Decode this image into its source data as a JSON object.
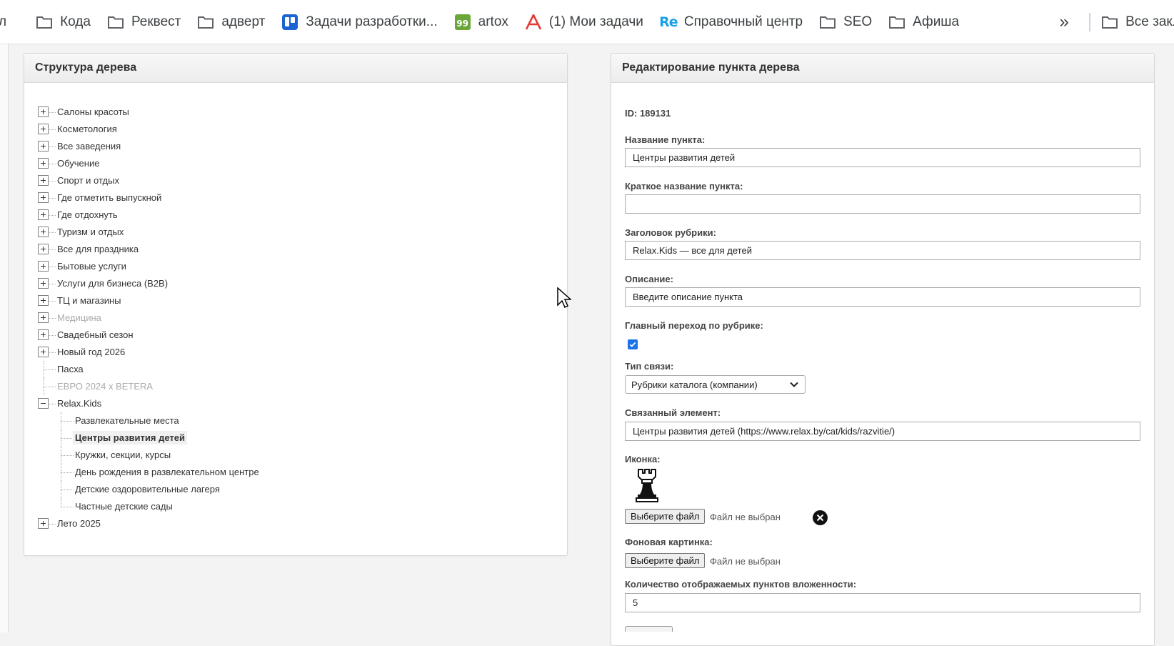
{
  "bookmarks": {
    "items": [
      {
        "label": "л",
        "icon": "folder-icon"
      },
      {
        "label": "Кода",
        "icon": "folder-icon"
      },
      {
        "label": "Реквест",
        "icon": "folder-icon"
      },
      {
        "label": "адверт",
        "icon": "folder-icon"
      },
      {
        "label": "Задачи разработки...",
        "icon": "trello-icon"
      },
      {
        "label": "artox",
        "icon": "artox-99-icon"
      },
      {
        "label": "(1) Мои задачи",
        "icon": "red-a-icon"
      },
      {
        "label": "Справочный центр",
        "icon": "re-icon"
      },
      {
        "label": "SEO",
        "icon": "folder-icon"
      },
      {
        "label": "Афиша",
        "icon": "folder-icon"
      }
    ],
    "more_label": "»",
    "all_bookmarks": "Все закладки"
  },
  "tree_panel": {
    "title": "Структура дерева",
    "nodes": [
      {
        "label": "Салоны красоты",
        "state": "collapsed"
      },
      {
        "label": "Косметология",
        "state": "collapsed"
      },
      {
        "label": "Все заведения",
        "state": "collapsed"
      },
      {
        "label": "Обучение",
        "state": "collapsed"
      },
      {
        "label": "Спорт и отдых",
        "state": "collapsed"
      },
      {
        "label": "Где отметить выпускной",
        "state": "collapsed"
      },
      {
        "label": "Где отдохнуть",
        "state": "collapsed"
      },
      {
        "label": "Туризм и отдых",
        "state": "collapsed"
      },
      {
        "label": "Все для праздника",
        "state": "collapsed"
      },
      {
        "label": "Бытовые услуги",
        "state": "collapsed"
      },
      {
        "label": "Услуги для бизнеса (B2B)",
        "state": "collapsed"
      },
      {
        "label": "ТЦ и магазины",
        "state": "collapsed"
      },
      {
        "label": "Медицина",
        "state": "collapsed",
        "disabled": true
      },
      {
        "label": "Свадебный сезон",
        "state": "collapsed"
      },
      {
        "label": "Новый год 2026",
        "state": "collapsed"
      },
      {
        "label": "Пасха",
        "state": "leaf"
      },
      {
        "label": "ЕВРО 2024 x BETERA",
        "state": "leaf",
        "disabled": true
      },
      {
        "label": "Relax.Kids",
        "state": "expanded"
      },
      {
        "label": "Развлекательные места",
        "state": "child"
      },
      {
        "label": "Центры развития детей",
        "state": "child",
        "selected": true
      },
      {
        "label": "Кружки, секции, курсы",
        "state": "child"
      },
      {
        "label": "День рождения в развлекательном центре",
        "state": "child"
      },
      {
        "label": "Детские оздоровительные лагеря",
        "state": "child"
      },
      {
        "label": "Частные детские сады",
        "state": "child"
      },
      {
        "label": "Лето 2025",
        "state": "collapsed"
      }
    ]
  },
  "edit_panel": {
    "title": "Редактирование пункта дерева",
    "id_text": "ID: 189131",
    "name_label": "Название пункта:",
    "name_value": "Центры развития детей",
    "short_name_label": "Краткое название пункта:",
    "short_name_value": "",
    "heading_label": "Заголовок рубрики:",
    "heading_value": "Relax.Kids — все для детей",
    "description_label": "Описание:",
    "description_value": "Введите описание пункта",
    "main_link_label": "Главный переход по рубрике:",
    "main_link_checked": true,
    "link_type_label": "Тип связи:",
    "link_type_value": "Рубрики каталога (компании)",
    "linked_element_label": "Связанный элемент:",
    "linked_element_value": "Центры развития детей (https://www.relax.by/cat/kids/razvitie/)",
    "icon_label": "Иконка:",
    "icon_image": "chess-rook-icon",
    "choose_file_label": "Выберите файл",
    "no_file_label": "Файл не выбран",
    "background_label": "Фоновая картинка:",
    "nested_count_label": "Количество отображаемых пунктов вложенности:",
    "nested_count_value": "5"
  }
}
